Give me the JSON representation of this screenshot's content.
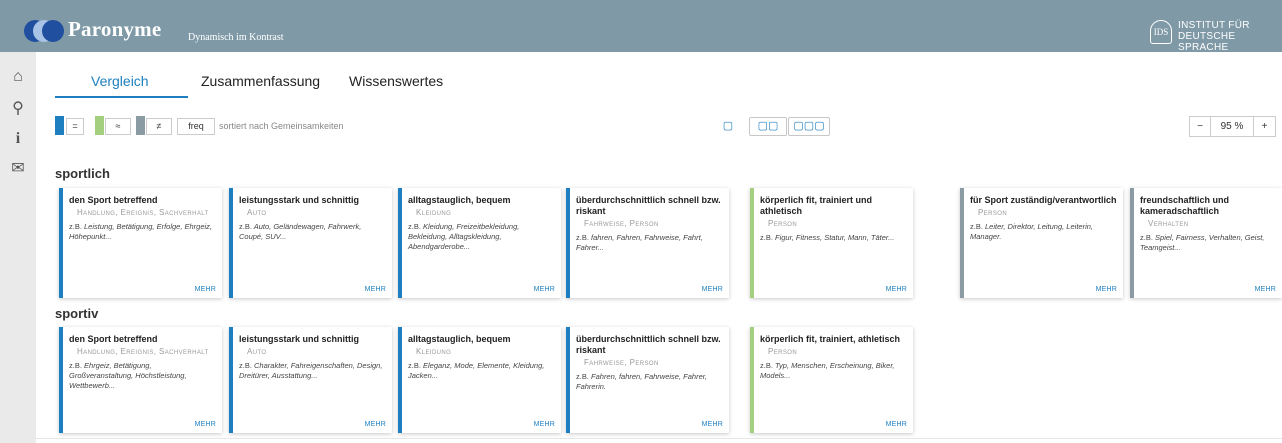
{
  "header": {
    "brand": "Paronyme",
    "tagline": "Dynamisch im Kontrast",
    "logo_text": "IDS",
    "institute_line1": "INSTITUT FÜR",
    "institute_line2": "DEUTSCHE SPRACHE",
    "bg_color": "#7f9aa6"
  },
  "sidebar": [
    {
      "icon": "home-icon",
      "glyph": "⌂"
    },
    {
      "icon": "search-icon",
      "glyph": "⚲"
    },
    {
      "icon": "info-icon",
      "glyph": "i"
    },
    {
      "icon": "mail-icon",
      "glyph": "✉"
    }
  ],
  "tabs": [
    {
      "label": "Vergleich",
      "active": true
    },
    {
      "label": "Zusammenfassung",
      "active": false
    },
    {
      "label": "Wissenswertes",
      "active": false
    }
  ],
  "toolbar": {
    "legend": [
      {
        "symbol": "=",
        "color": "#1e7fc0"
      },
      {
        "symbol": "≈",
        "color": "#a3cf7f"
      },
      {
        "symbol": "≠",
        "color": "#8a9ba3"
      }
    ],
    "freq_label": "freq",
    "sort_label": "sortiert nach Gemeinsamkeiten",
    "view_options": [
      "▢",
      "▢▢",
      "▢▢▢"
    ],
    "zoom_minus": "−",
    "zoom_value": "95 %",
    "zoom_plus": "+"
  },
  "sections": [
    {
      "title": "sportlich",
      "cards": [
        {
          "title": "den Sport betreffend",
          "category": "Handlung, Ereignis, Sachverhalt",
          "example_lead": "z.B.",
          "examples": "Leistung, Betätigung, Erfolge, Ehrgeiz, Höhepunkt...",
          "more": "MEHR",
          "border": "#1e7fc0"
        },
        {
          "title": "leistungsstark und schnittig",
          "category": "Auto",
          "example_lead": "z.B.",
          "examples": "Auto, Geländewagen, Fahrwerk, Coupé, SUV...",
          "more": "MEHR",
          "border": "#1e7fc0"
        },
        {
          "title": "alltagstauglich, bequem",
          "category": "Kleidung",
          "example_lead": "z.B.",
          "examples": "Kleidung, Freizeitbekleidung, Bekleidung, Alltagskleidung, Abendgarderobe...",
          "more": "MEHR",
          "border": "#1e7fc0"
        },
        {
          "title": "überdurchschnittlich schnell bzw. riskant",
          "category": "Fahrweise, Person",
          "example_lead": "z.B.",
          "examples": "fahren, Fahren, Fahrweise, Fahrt, Fahrer...",
          "more": "MEHR",
          "border": "#1e7fc0"
        },
        {
          "title": "körperlich fit, trainiert und athletisch",
          "category": "Person",
          "example_lead": "z.B.",
          "examples": "Figur, Fitness, Statur, Mann, Täter...",
          "more": "MEHR",
          "border": "#a3cf7f"
        },
        {
          "title": "für Sport zuständig/verantwortlich",
          "category": "Person",
          "example_lead": "z.B.",
          "examples": "Leiter, Direktor, Leitung, Leiterin, Manager.",
          "more": "MEHR",
          "border": "#8a9ba3"
        },
        {
          "title": "freundschaftlich und kameradschaftlich",
          "category": "Verhalten",
          "example_lead": "z.B.",
          "examples": "Spiel, Fairness, Verhalten, Geist, Teamgeist...",
          "more": "MEHR",
          "border": "#8a9ba3"
        }
      ]
    },
    {
      "title": "sportiv",
      "cards": [
        {
          "title": "den Sport betreffend",
          "category": "Handlung, Ereignis, Sachverhalt",
          "example_lead": "z.B.",
          "examples": "Ehrgeiz, Betätigung, Großveranstaltung, Höchstleistung, Wettbewerb...",
          "more": "MEHR",
          "border": "#1e7fc0"
        },
        {
          "title": "leistungsstark und schnittig",
          "category": "Auto",
          "example_lead": "z.B.",
          "examples": "Charakter, Fahreigenschaften, Design, Dreitürer, Ausstattung...",
          "more": "MEHR",
          "border": "#1e7fc0"
        },
        {
          "title": "alltagstauglich, bequem",
          "category": "Kleidung",
          "example_lead": "z.B.",
          "examples": "Eleganz, Mode, Elemente, Kleidung, Jacken...",
          "more": "MEHR",
          "border": "#1e7fc0"
        },
        {
          "title": "überdurchschnittlich schnell bzw. riskant",
          "category": "Fahrweise, Person",
          "example_lead": "z.B.",
          "examples": "Fahren, fahren, Fahrweise, Fahrer, Fahrerin.",
          "more": "MEHR",
          "border": "#1e7fc0"
        },
        {
          "title": "körperlich fit, trainiert, athletisch",
          "category": "Person",
          "example_lead": "z.B.",
          "examples": "Typ, Menschen, Erscheinung, Biker, Models...",
          "more": "MEHR",
          "border": "#a3cf7f"
        }
      ]
    }
  ]
}
